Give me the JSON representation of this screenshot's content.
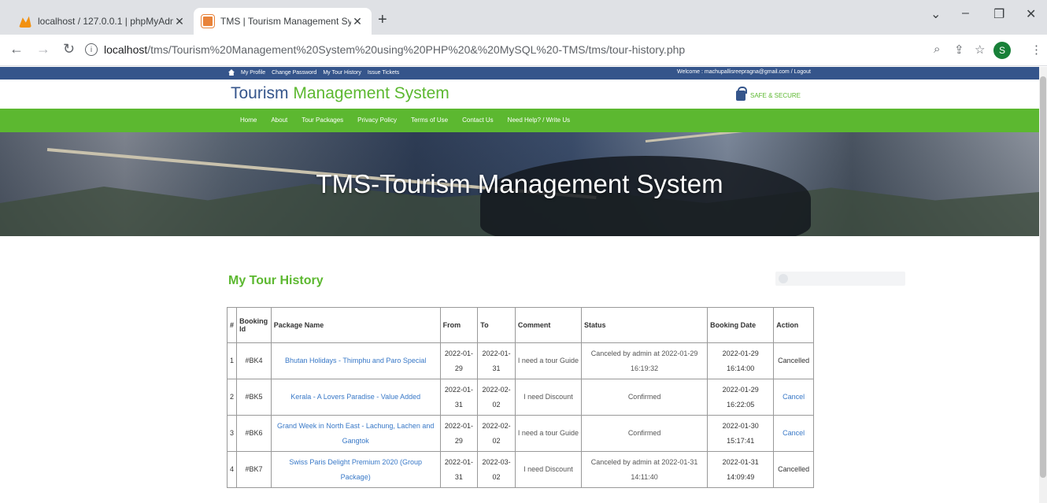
{
  "browser": {
    "tabs": [
      {
        "title": "localhost / 127.0.0.1 | phpMyAdm",
        "active": false
      },
      {
        "title": "TMS | Tourism Management Syst",
        "active": true
      }
    ],
    "url_host": "localhost",
    "url_path": "/tms/Tourism%20Management%20System%20using%20PHP%20&%20MySQL%20-TMS/tms/tour-history.php",
    "profile_initial": "S"
  },
  "site": {
    "top_links": [
      "My Profile",
      "Change Password",
      "My Tour History",
      "Issue Tickets"
    ],
    "welcome_text": "Welcome :  machupallisreepragna@gmail.com / Logout",
    "brand_part1": "Tourism",
    "brand_part2": "Management System",
    "safe_label": "SAFE & SECURE",
    "menu": [
      "Home",
      "About",
      "Tour Packages",
      "Privacy Policy",
      "Terms of Use",
      "Contact Us",
      "Need Help? / Write Us"
    ],
    "banner_title": "TMS-Tourism Management System"
  },
  "history": {
    "title": "My Tour History",
    "columns": [
      "#",
      "Booking Id",
      "Package Name",
      "From",
      "To",
      "Comment",
      "Status",
      "Booking Date",
      "Action"
    ],
    "rows": [
      {
        "num": "1",
        "id": "#BK4",
        "package": "Bhutan Holidays - Thimphu and Paro Special",
        "from": "2022-01-29",
        "to": "2022-01-31",
        "comment": "I need a tour Guide",
        "status": "Canceled by admin at 2022-01-29 16:19:32",
        "date": "2022-01-29 16:14:00",
        "action": "Cancelled"
      },
      {
        "num": "2",
        "id": "#BK5",
        "package": "Kerala - A Lovers Paradise - Value Added",
        "from": "2022-01-31",
        "to": "2022-02-02",
        "comment": "I need Discount",
        "status": "Confirmed",
        "date": "2022-01-29 16:22:05",
        "action": "Cancel"
      },
      {
        "num": "3",
        "id": "#BK6",
        "package": "Grand Week in North East - Lachung, Lachen and Gangtok",
        "from": "2022-01-29",
        "to": "2022-02-02",
        "comment": "I need a tour Guide",
        "status": "Confirmed",
        "date": "2022-01-30 15:17:41",
        "action": "Cancel"
      },
      {
        "num": "4",
        "id": "#BK7",
        "package": "Swiss Paris Delight Premium 2020 (Group Package)",
        "from": "2022-01-31",
        "to": "2022-03-02",
        "comment": "I need Discount",
        "status": "Canceled by admin at 2022-01-31 14:11:40",
        "date": "2022-01-31 14:09:49",
        "action": "Cancelled"
      }
    ]
  }
}
